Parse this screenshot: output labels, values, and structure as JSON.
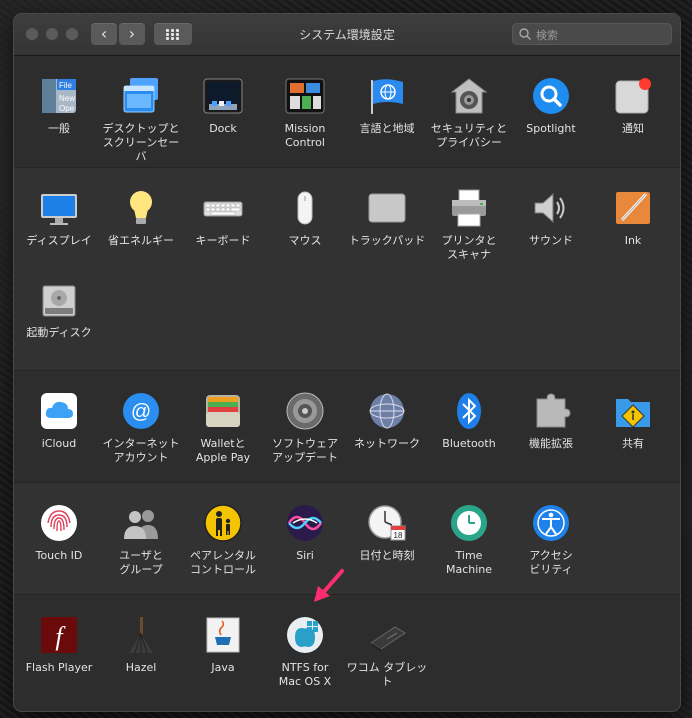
{
  "window": {
    "title": "システム環境設定",
    "search_placeholder": "検索"
  },
  "sections": [
    {
      "items": [
        {
          "id": "general",
          "label": "一般",
          "icon": "general-icon"
        },
        {
          "id": "desktop",
          "label": "デスクトップと\nスクリーンセーバ",
          "icon": "desktop-screensaver-icon"
        },
        {
          "id": "dock",
          "label": "Dock",
          "icon": "dock-icon"
        },
        {
          "id": "mission",
          "label": "Mission\nControl",
          "icon": "mission-control-icon"
        },
        {
          "id": "language",
          "label": "言語と地域",
          "icon": "language-region-icon"
        },
        {
          "id": "security",
          "label": "セキュリティと\nプライバシー",
          "icon": "security-privacy-icon"
        },
        {
          "id": "spotlight",
          "label": "Spotlight",
          "icon": "spotlight-icon"
        },
        {
          "id": "notifications",
          "label": "通知",
          "icon": "notifications-icon"
        }
      ]
    },
    {
      "items": [
        {
          "id": "displays",
          "label": "ディスプレイ",
          "icon": "display-icon"
        },
        {
          "id": "energy",
          "label": "省エネルギー",
          "icon": "energy-saver-icon"
        },
        {
          "id": "keyboard",
          "label": "キーボード",
          "icon": "keyboard-icon"
        },
        {
          "id": "mouse",
          "label": "マウス",
          "icon": "mouse-icon"
        },
        {
          "id": "trackpad",
          "label": "トラックパッド",
          "icon": "trackpad-icon"
        },
        {
          "id": "printers",
          "label": "プリンタと\nスキャナ",
          "icon": "printer-icon"
        },
        {
          "id": "sound",
          "label": "サウンド",
          "icon": "sound-icon"
        },
        {
          "id": "ink",
          "label": "Ink",
          "icon": "ink-icon"
        },
        {
          "id": "startup",
          "label": "起動ディスク",
          "icon": "startup-disk-icon"
        }
      ]
    },
    {
      "items": [
        {
          "id": "icloud",
          "label": "iCloud",
          "icon": "icloud-icon"
        },
        {
          "id": "internet",
          "label": "インターネット\nアカウント",
          "icon": "internet-accounts-icon"
        },
        {
          "id": "wallet",
          "label": "Walletと\nApple Pay",
          "icon": "wallet-icon"
        },
        {
          "id": "softwareupdate",
          "label": "ソフトウェア\nアップデート",
          "icon": "software-update-icon"
        },
        {
          "id": "network",
          "label": "ネットワーク",
          "icon": "network-icon"
        },
        {
          "id": "bluetooth",
          "label": "Bluetooth",
          "icon": "bluetooth-icon"
        },
        {
          "id": "extensions",
          "label": "機能拡張",
          "icon": "extensions-icon"
        },
        {
          "id": "sharing",
          "label": "共有",
          "icon": "sharing-icon"
        }
      ]
    },
    {
      "items": [
        {
          "id": "touchid",
          "label": "Touch ID",
          "icon": "fingerprint-icon"
        },
        {
          "id": "users",
          "label": "ユーザと\nグループ",
          "icon": "users-groups-icon"
        },
        {
          "id": "parental",
          "label": "ペアレンタル\nコントロール",
          "icon": "parental-controls-icon"
        },
        {
          "id": "siri",
          "label": "Siri",
          "icon": "siri-icon"
        },
        {
          "id": "datetime",
          "label": "日付と時刻",
          "icon": "date-time-icon"
        },
        {
          "id": "timemachine",
          "label": "Time\nMachine",
          "icon": "time-machine-icon"
        },
        {
          "id": "accessibility",
          "label": "アクセシ\nビリティ",
          "icon": "accessibility-icon"
        }
      ]
    },
    {
      "items": [
        {
          "id": "flash",
          "label": "Flash Player",
          "icon": "flash-player-icon"
        },
        {
          "id": "hazel",
          "label": "Hazel",
          "icon": "hazel-icon"
        },
        {
          "id": "java",
          "label": "Java",
          "icon": "java-icon"
        },
        {
          "id": "ntfs",
          "label": "NTFS for\nMac OS X",
          "icon": "ntfs-icon"
        },
        {
          "id": "wacom",
          "label": "ワコム タブレット",
          "icon": "wacom-tablet-icon"
        }
      ]
    }
  ],
  "colors": {
    "window_bg": "#2b2b2b",
    "annotation_arrow": "#ff2d6f"
  }
}
